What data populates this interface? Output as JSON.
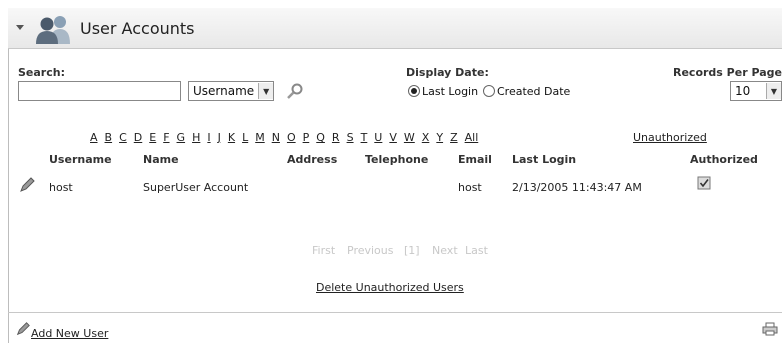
{
  "header": {
    "title": "User Accounts"
  },
  "search": {
    "label": "Search:",
    "value": "",
    "filter_selected": "Username"
  },
  "display_date": {
    "label": "Display Date:",
    "options": [
      "Last Login",
      "Created Date"
    ],
    "selected": "Last Login"
  },
  "records": {
    "label": "Records Per Page:",
    "value": "10"
  },
  "alphabet": [
    "A",
    "B",
    "C",
    "D",
    "E",
    "F",
    "G",
    "H",
    "I",
    "J",
    "K",
    "L",
    "M",
    "N",
    "O",
    "P",
    "Q",
    "R",
    "S",
    "T",
    "U",
    "V",
    "W",
    "X",
    "Y",
    "Z",
    "All"
  ],
  "unauthorized_label": "Unauthorized",
  "table": {
    "headers": [
      "Username",
      "Name",
      "Address",
      "Telephone",
      "Email",
      "Last Login",
      "Authorized"
    ],
    "rows": [
      {
        "username": "host",
        "name": "SuperUser Account",
        "address": "",
        "telephone": "",
        "email": "host",
        "last_login": "2/13/2005 11:43:47 AM",
        "authorized": true
      }
    ]
  },
  "pager": {
    "first": "First",
    "previous": "Previous",
    "current": "[1]",
    "next": "Next",
    "last": "Last"
  },
  "actions": {
    "delete_unauthorized": "Delete Unauthorized Users",
    "add_new_user": "Add New User"
  }
}
